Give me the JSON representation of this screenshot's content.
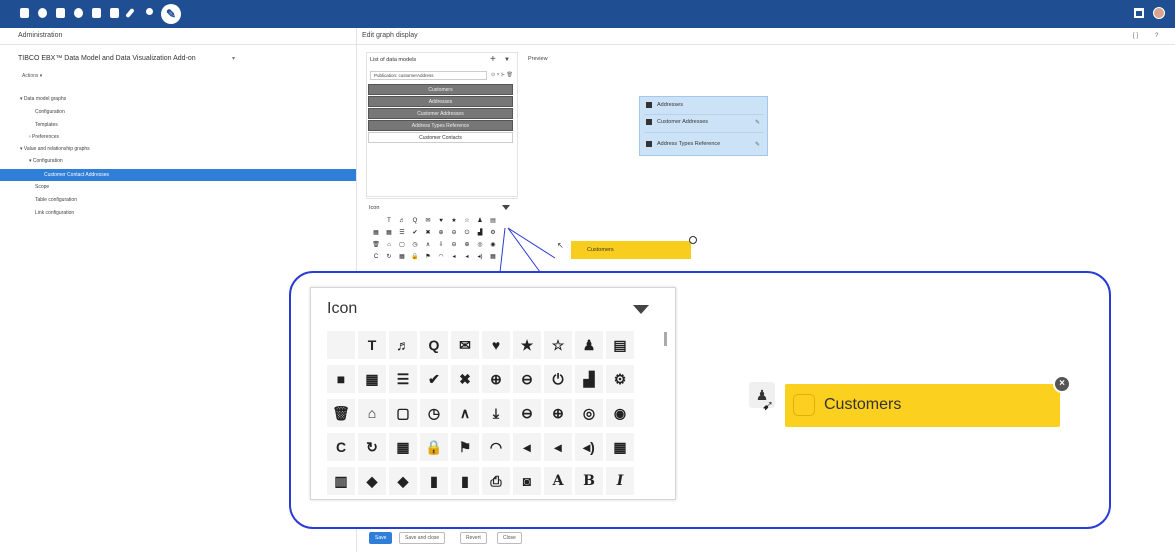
{
  "left": {
    "header": "Administration",
    "app_title": "TIBCO EBX™ Data Model and Data Visualization Add-on",
    "actions_label": "Actions ▾",
    "tree": [
      {
        "label": "▾ Data model graphs"
      },
      {
        "label": "Configuration"
      },
      {
        "label": "Templates"
      },
      {
        "label": "› Preferences"
      },
      {
        "label": "▾ Value and relationship graphs"
      },
      {
        "label": "▾ Configuration"
      },
      {
        "label": "Customer Contact Addresses"
      },
      {
        "label": "Scope"
      },
      {
        "label": "Table configuration"
      },
      {
        "label": "Link configuration"
      }
    ]
  },
  "right": {
    "header": "Edit graph display",
    "header_icons": [
      "[ ]",
      "?"
    ]
  },
  "data_models": {
    "title": "List of data models",
    "add_icon": "+",
    "menu_icon": "▼",
    "input_value": "Publication: customerAddress",
    "tools": "⊙ × ⊱ 🗑",
    "rows": [
      "Customers",
      "Addresses",
      "Customer Addresses",
      "Address Types Reference",
      "Customer Contacts"
    ]
  },
  "icon_panel": {
    "title": "Icon",
    "small_icons": [
      "",
      "T",
      "♬",
      "Q",
      "✉",
      "♥",
      "★",
      "☆",
      "♟",
      "▤",
      "▦",
      "▦",
      "☰",
      "✔",
      "✖",
      "⊕",
      "⊖",
      "⏻",
      "▟",
      "⚙",
      "🗑",
      "⌂",
      "▢",
      "◷",
      "∧",
      "⇩",
      "⊖",
      "⊕",
      "◎",
      "◉",
      "C",
      "↻",
      "▦",
      "🔒",
      "⚑",
      "◠",
      "◂",
      "◂",
      "◂)",
      "▦"
    ]
  },
  "zoom": {
    "title": "Icon",
    "icons": [
      "",
      "T",
      "♬",
      "Q",
      "✉",
      "♥",
      "★",
      "☆",
      "♟",
      "▤",
      "■",
      "▦",
      "☰",
      "✔",
      "✖",
      "⊕",
      "⊖",
      "⏻",
      "▟",
      "⚙",
      "🗑",
      "⌂",
      "▢",
      "◷",
      "∧",
      "⤓",
      "⊖",
      "⊕",
      "◎",
      "◉",
      "C",
      "↻",
      "▦",
      "🔒",
      "⚑",
      "◠",
      "◂",
      "◂",
      "◂)",
      "▦",
      "▥",
      "◆",
      "◆",
      "▮",
      "▮",
      "⎙",
      "◙",
      "A",
      "B",
      "I"
    ],
    "customers_label": "Customers",
    "close_glyph": "×",
    "person_glyph": "♟",
    "cursor_glyph": "➹"
  },
  "preview": {
    "title": "Preview",
    "node_rows": [
      {
        "label": "Addresses"
      },
      {
        "label": "Customer Addresses"
      },
      {
        "label": "Address Types Reference"
      }
    ],
    "edit_icon": "✎",
    "customers_label": "Customers"
  },
  "buttons": {
    "save": "Save",
    "save_close": "Save and close",
    "revert": "Revert",
    "close": "Close"
  }
}
